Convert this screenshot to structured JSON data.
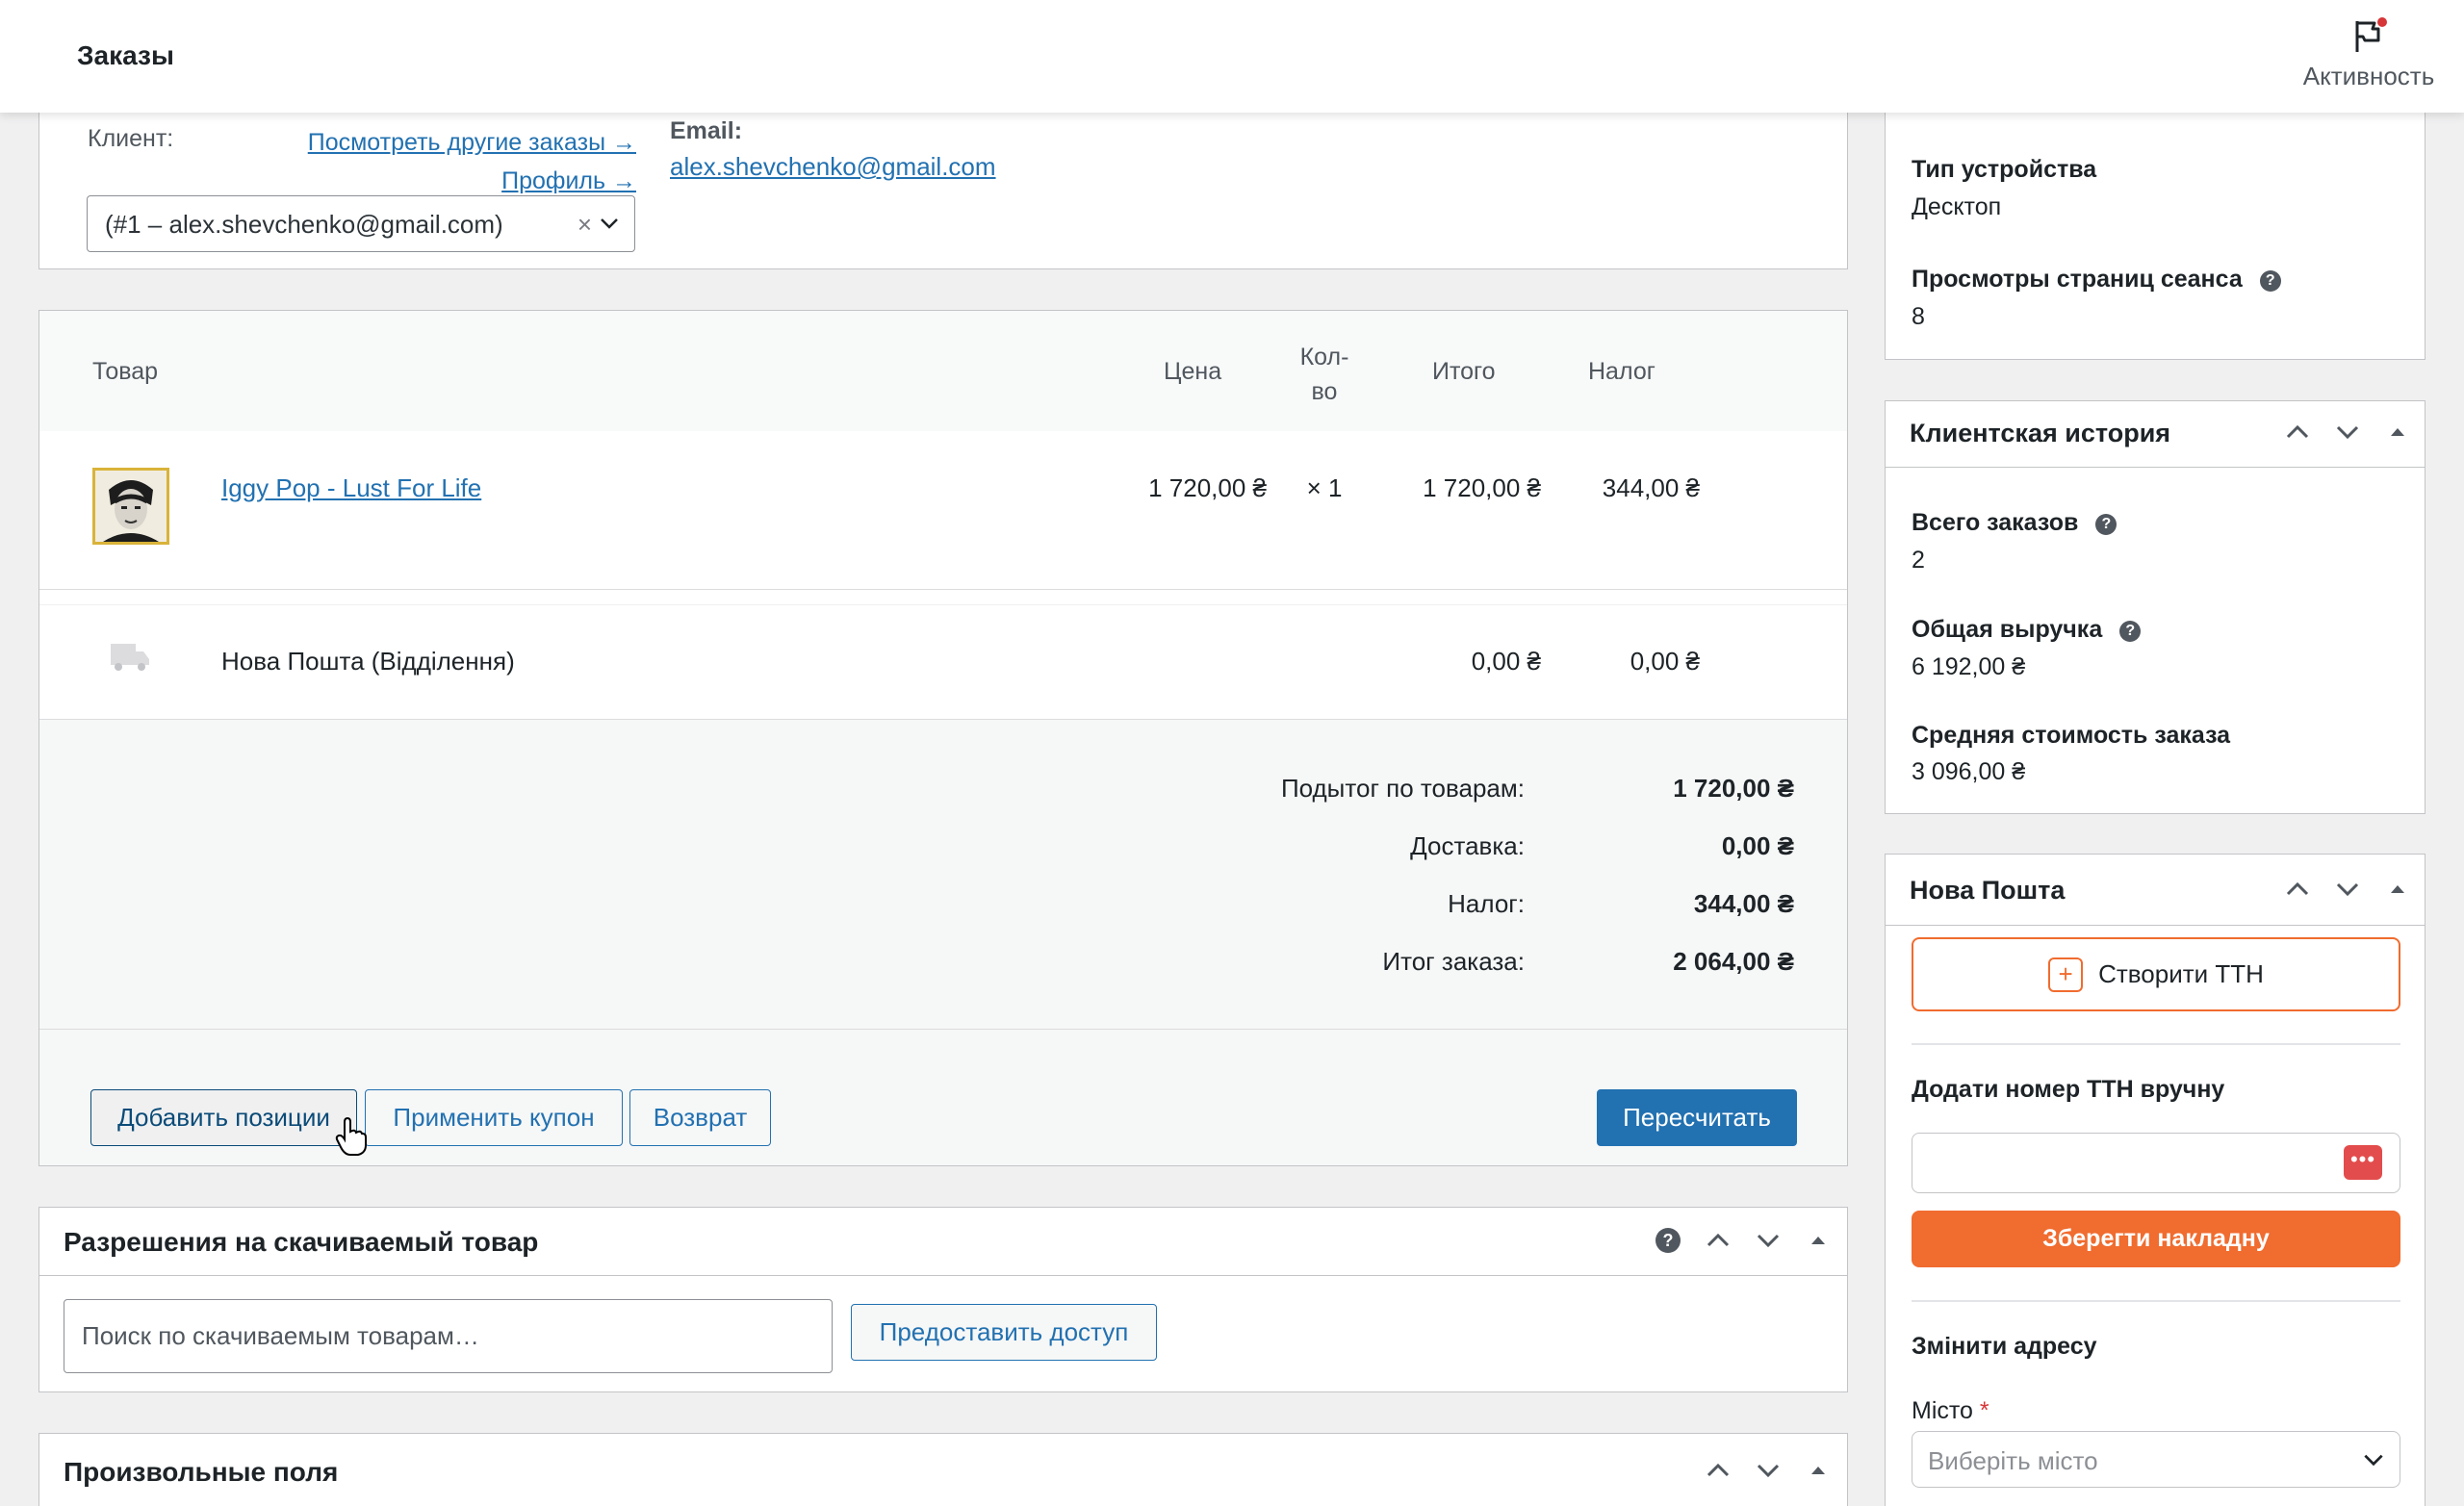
{
  "header": {
    "title": "Заказы",
    "activity_label": "Активность"
  },
  "customer": {
    "label": "Клиент:",
    "view_other_orders": "Посмотреть другие заказы →",
    "profile": "Профиль →",
    "selected": "(#1 – alex.shevchenko@gmail.com)",
    "clear": "×",
    "email_label": "Email:",
    "email": "alex.shevchenko@gmail.com"
  },
  "items": {
    "columns": {
      "product": "Товар",
      "price": "Цена",
      "qty_top": "Кол-",
      "qty_bottom": "во",
      "total": "Итого",
      "tax": "Налог"
    },
    "rows": [
      {
        "name": "Iggy Pop - Lust For Life",
        "price": "1 720,00 ₴",
        "qty": "× 1",
        "total": "1 720,00 ₴",
        "tax": "344,00 ₴"
      }
    ],
    "shipping": {
      "name": "Нова Пошта (Відділення)",
      "total": "0,00 ₴",
      "tax": "0,00 ₴"
    },
    "totals": [
      {
        "label": "Подытог по товарам:",
        "value": "1 720,00 ₴"
      },
      {
        "label": "Доставка:",
        "value": "0,00 ₴"
      },
      {
        "label": "Налог:",
        "value": "344,00 ₴"
      },
      {
        "label": "Итог заказа:",
        "value": "2 064,00 ₴"
      }
    ],
    "buttons": {
      "add_items": "Добавить позиции",
      "apply_coupon": "Применить купон",
      "refund": "Возврат",
      "recalculate": "Пересчитать"
    }
  },
  "downloads": {
    "title": "Разрешения на скачиваемый товар",
    "search_placeholder": "Поиск по скачиваемым товарам…",
    "grant_button": "Предоставить доступ"
  },
  "custom_fields": {
    "title": "Произвольные поля"
  },
  "device": {
    "device_type_label": "Тип устройства",
    "device_type_value": "Десктоп",
    "pageviews_label": "Просмотры страниц сеанса",
    "pageviews_value": "8"
  },
  "history": {
    "title": "Клиентская история",
    "total_orders_label": "Всего заказов",
    "total_orders_value": "2",
    "revenue_label": "Общая выручка",
    "revenue_value": "6 192,00 ₴",
    "avg_label": "Средняя стоимость заказа",
    "avg_value": "3 096,00 ₴"
  },
  "nova_poshta": {
    "title": "Нова Пошта",
    "create_button": "Створити ТТН",
    "manual_label": "Додати номер ТТН вручну",
    "save_button": "Зберегти накладну",
    "change_address": "Змінити адресу",
    "city_label": "Місто",
    "required_mark": "*",
    "city_placeholder": "Виберіть місто"
  },
  "colors": {
    "accent": "#2271b1",
    "nova_poshta": "#f06c2f",
    "badge": "#d63638"
  }
}
